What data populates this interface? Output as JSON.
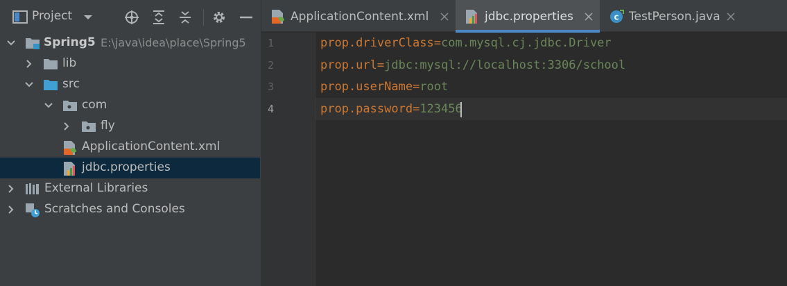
{
  "project_panel": {
    "title": "Project",
    "tree": {
      "root": {
        "label": "Spring5",
        "path": "E:\\java\\idea\\place\\Spring5"
      },
      "lib": "lib",
      "src": "src",
      "com": "com",
      "fly": "fly",
      "file_xml": "ApplicationContent.xml",
      "file_props": "jdbc.properties",
      "external_libraries": "External Libraries",
      "scratches": "Scratches and Consoles"
    }
  },
  "editor": {
    "tabs": [
      {
        "label": "ApplicationContent.xml",
        "icon": "xml-spring-icon"
      },
      {
        "label": "jdbc.properties",
        "icon": "properties-icon",
        "active": true
      },
      {
        "label": "TestPerson.java",
        "icon": "java-class-icon"
      }
    ],
    "line_numbers": [
      "1",
      "2",
      "3",
      "4"
    ],
    "lines": [
      {
        "key": "prop.driverClass",
        "sep": "=",
        "value": "com.mysql.cj.jdbc.Driver"
      },
      {
        "key": "prop.url",
        "sep": "=",
        "value": "jdbc:mysql://localhost:3306/school"
      },
      {
        "key": "prop.userName",
        "sep": "=",
        "value": "root"
      },
      {
        "key": "prop.password",
        "sep": "=",
        "value": "123456"
      }
    ]
  },
  "colors": {
    "key": "#cc7832",
    "value": "#6a8759",
    "accent": "#4a88c7",
    "selection": "#0d293e"
  }
}
